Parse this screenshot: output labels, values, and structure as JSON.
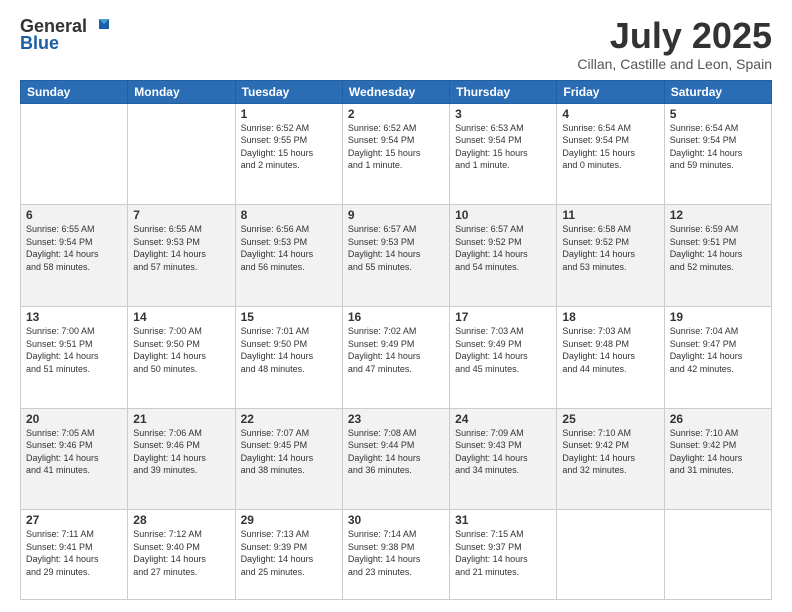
{
  "header": {
    "logo_line1": "General",
    "logo_line2": "Blue",
    "month": "July 2025",
    "location": "Cillan, Castille and Leon, Spain"
  },
  "weekdays": [
    "Sunday",
    "Monday",
    "Tuesday",
    "Wednesday",
    "Thursday",
    "Friday",
    "Saturday"
  ],
  "weeks": [
    [
      {
        "day": "",
        "info": ""
      },
      {
        "day": "",
        "info": ""
      },
      {
        "day": "1",
        "info": "Sunrise: 6:52 AM\nSunset: 9:55 PM\nDaylight: 15 hours\nand 2 minutes."
      },
      {
        "day": "2",
        "info": "Sunrise: 6:52 AM\nSunset: 9:54 PM\nDaylight: 15 hours\nand 1 minute."
      },
      {
        "day": "3",
        "info": "Sunrise: 6:53 AM\nSunset: 9:54 PM\nDaylight: 15 hours\nand 1 minute."
      },
      {
        "day": "4",
        "info": "Sunrise: 6:54 AM\nSunset: 9:54 PM\nDaylight: 15 hours\nand 0 minutes."
      },
      {
        "day": "5",
        "info": "Sunrise: 6:54 AM\nSunset: 9:54 PM\nDaylight: 14 hours\nand 59 minutes."
      }
    ],
    [
      {
        "day": "6",
        "info": "Sunrise: 6:55 AM\nSunset: 9:54 PM\nDaylight: 14 hours\nand 58 minutes."
      },
      {
        "day": "7",
        "info": "Sunrise: 6:55 AM\nSunset: 9:53 PM\nDaylight: 14 hours\nand 57 minutes."
      },
      {
        "day": "8",
        "info": "Sunrise: 6:56 AM\nSunset: 9:53 PM\nDaylight: 14 hours\nand 56 minutes."
      },
      {
        "day": "9",
        "info": "Sunrise: 6:57 AM\nSunset: 9:53 PM\nDaylight: 14 hours\nand 55 minutes."
      },
      {
        "day": "10",
        "info": "Sunrise: 6:57 AM\nSunset: 9:52 PM\nDaylight: 14 hours\nand 54 minutes."
      },
      {
        "day": "11",
        "info": "Sunrise: 6:58 AM\nSunset: 9:52 PM\nDaylight: 14 hours\nand 53 minutes."
      },
      {
        "day": "12",
        "info": "Sunrise: 6:59 AM\nSunset: 9:51 PM\nDaylight: 14 hours\nand 52 minutes."
      }
    ],
    [
      {
        "day": "13",
        "info": "Sunrise: 7:00 AM\nSunset: 9:51 PM\nDaylight: 14 hours\nand 51 minutes."
      },
      {
        "day": "14",
        "info": "Sunrise: 7:00 AM\nSunset: 9:50 PM\nDaylight: 14 hours\nand 50 minutes."
      },
      {
        "day": "15",
        "info": "Sunrise: 7:01 AM\nSunset: 9:50 PM\nDaylight: 14 hours\nand 48 minutes."
      },
      {
        "day": "16",
        "info": "Sunrise: 7:02 AM\nSunset: 9:49 PM\nDaylight: 14 hours\nand 47 minutes."
      },
      {
        "day": "17",
        "info": "Sunrise: 7:03 AM\nSunset: 9:49 PM\nDaylight: 14 hours\nand 45 minutes."
      },
      {
        "day": "18",
        "info": "Sunrise: 7:03 AM\nSunset: 9:48 PM\nDaylight: 14 hours\nand 44 minutes."
      },
      {
        "day": "19",
        "info": "Sunrise: 7:04 AM\nSunset: 9:47 PM\nDaylight: 14 hours\nand 42 minutes."
      }
    ],
    [
      {
        "day": "20",
        "info": "Sunrise: 7:05 AM\nSunset: 9:46 PM\nDaylight: 14 hours\nand 41 minutes."
      },
      {
        "day": "21",
        "info": "Sunrise: 7:06 AM\nSunset: 9:46 PM\nDaylight: 14 hours\nand 39 minutes."
      },
      {
        "day": "22",
        "info": "Sunrise: 7:07 AM\nSunset: 9:45 PM\nDaylight: 14 hours\nand 38 minutes."
      },
      {
        "day": "23",
        "info": "Sunrise: 7:08 AM\nSunset: 9:44 PM\nDaylight: 14 hours\nand 36 minutes."
      },
      {
        "day": "24",
        "info": "Sunrise: 7:09 AM\nSunset: 9:43 PM\nDaylight: 14 hours\nand 34 minutes."
      },
      {
        "day": "25",
        "info": "Sunrise: 7:10 AM\nSunset: 9:42 PM\nDaylight: 14 hours\nand 32 minutes."
      },
      {
        "day": "26",
        "info": "Sunrise: 7:10 AM\nSunset: 9:42 PM\nDaylight: 14 hours\nand 31 minutes."
      }
    ],
    [
      {
        "day": "27",
        "info": "Sunrise: 7:11 AM\nSunset: 9:41 PM\nDaylight: 14 hours\nand 29 minutes."
      },
      {
        "day": "28",
        "info": "Sunrise: 7:12 AM\nSunset: 9:40 PM\nDaylight: 14 hours\nand 27 minutes."
      },
      {
        "day": "29",
        "info": "Sunrise: 7:13 AM\nSunset: 9:39 PM\nDaylight: 14 hours\nand 25 minutes."
      },
      {
        "day": "30",
        "info": "Sunrise: 7:14 AM\nSunset: 9:38 PM\nDaylight: 14 hours\nand 23 minutes."
      },
      {
        "day": "31",
        "info": "Sunrise: 7:15 AM\nSunset: 9:37 PM\nDaylight: 14 hours\nand 21 minutes."
      },
      {
        "day": "",
        "info": ""
      },
      {
        "day": "",
        "info": ""
      }
    ]
  ]
}
